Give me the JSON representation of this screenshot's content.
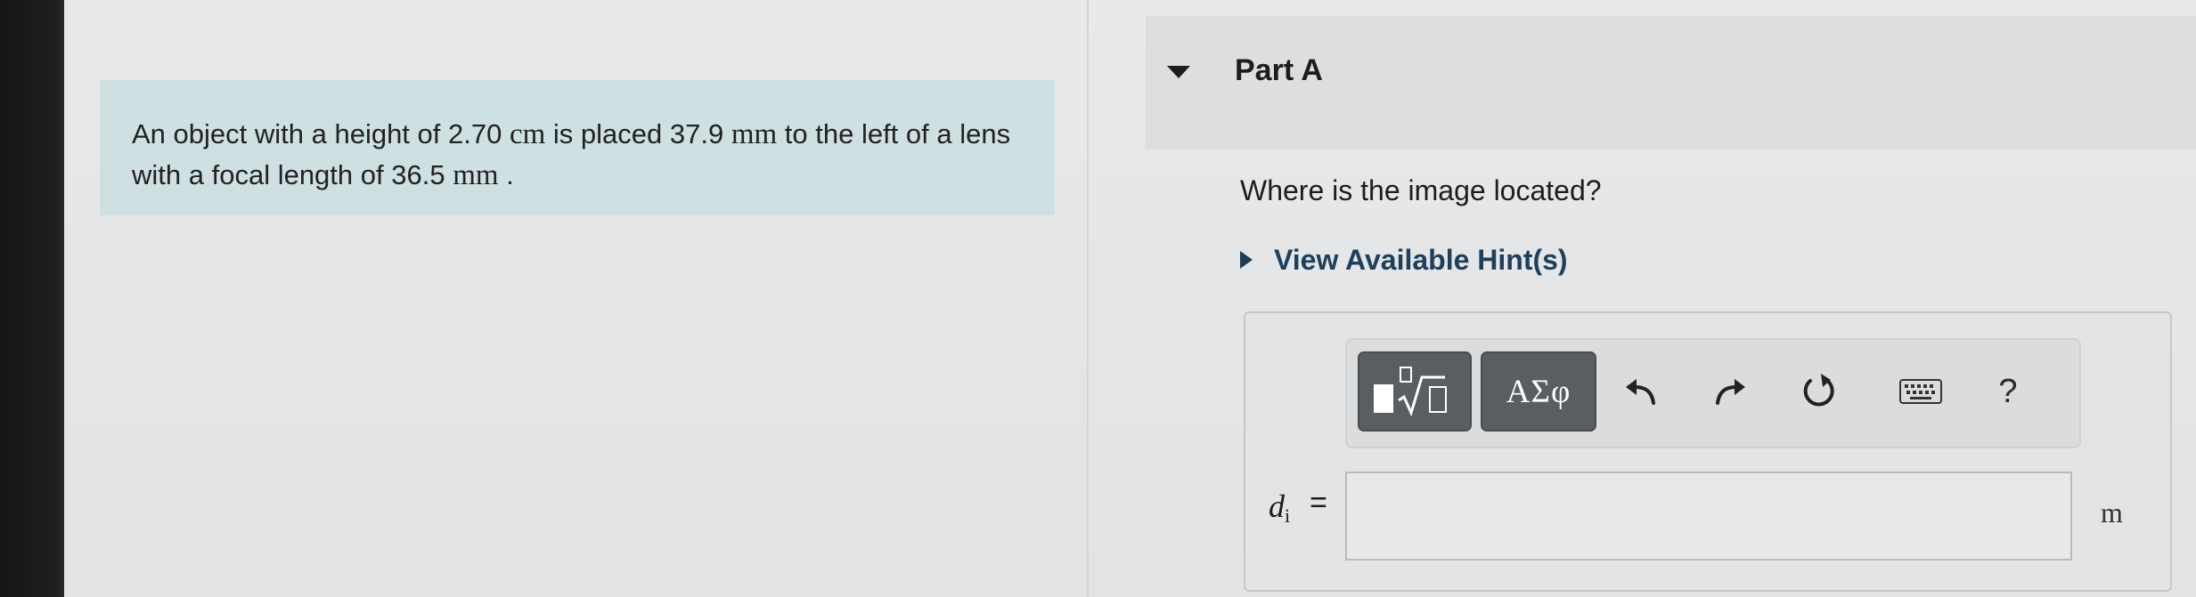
{
  "problem": {
    "text_1": "An object with a height of 2.70 ",
    "unit_1": "cm",
    "text_2": " is placed 37.9 ",
    "unit_2": "mm",
    "text_3": " to the left of a lens with a focal length of 36.5 ",
    "unit_3": "mm",
    "text_4": " ."
  },
  "part": {
    "title": "Part A",
    "question": "Where is the image located?",
    "hints_label": "View Available Hint(s)"
  },
  "toolbar": {
    "templates_icon": "templates-icon",
    "symbols_label": "ΑΣφ",
    "undo_icon": "undo-icon",
    "redo_icon": "redo-icon",
    "reset_icon": "reset-icon",
    "keyboard_icon": "keyboard-icon",
    "help_label": "?"
  },
  "answer": {
    "variable": "d",
    "subscript": "i",
    "equals": "=",
    "value": "",
    "unit": "m"
  },
  "colors": {
    "problem_bg": "#cfe0e2",
    "hint_link": "#1e405c",
    "dark_button": "#5b5e61"
  }
}
